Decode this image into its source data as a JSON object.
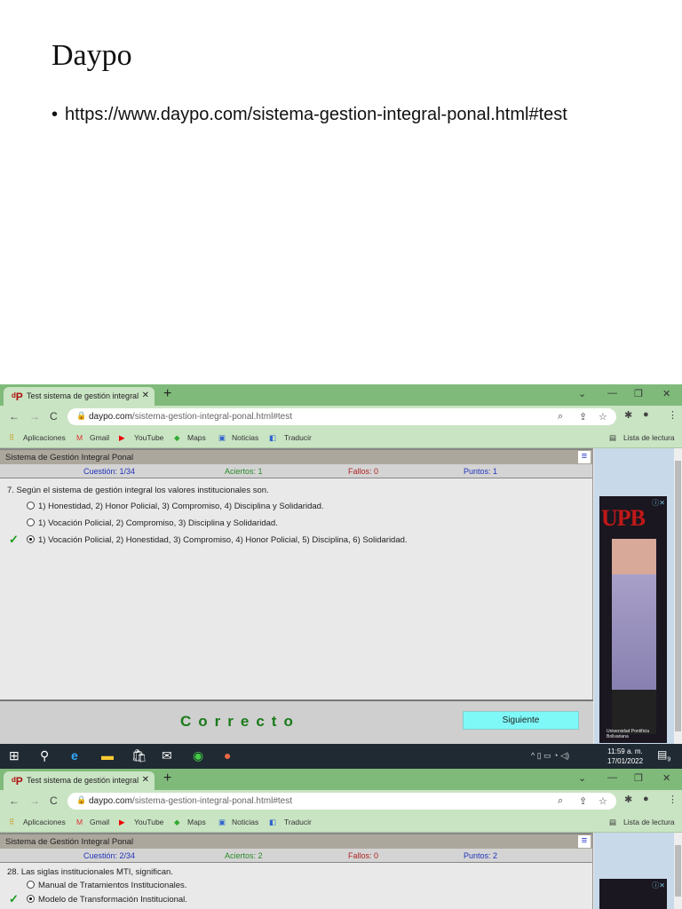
{
  "slide": {
    "title": "Daypo",
    "bullet": "https://www.daypo.com/sistema-gestion-integral-ponal.html#test"
  },
  "browser": {
    "tab_title": "Test sistema de gestión integral",
    "url_domain": "daypo.com",
    "url_path": "/sistema-gestion-integral-ponal.html#test",
    "bookmarks": [
      "Aplicaciones",
      "Gmail",
      "YouTube",
      "Maps",
      "Noticias",
      "Traducir"
    ],
    "reading_list": "Lista de lectura"
  },
  "quiz_title": "Sistema de Gestión Integral Ponal",
  "labels": {
    "question": "Cuestión:",
    "hits": "Aciertos:",
    "fails": "Fallos:",
    "points": "Puntos:"
  },
  "screens": [
    {
      "question_no": "1/34",
      "hits": "1",
      "fails": "0",
      "points": "1",
      "question": "7. Según el sistema de gestión integral los valores institucionales son.",
      "options": [
        "1) Honestidad, 2) Honor Policial, 3) Compromiso, 4) Disciplina y Solidaridad.",
        "1) Vocación Policial, 2) Compromiso, 3) Disciplina y Solidaridad.",
        "1) Vocación Policial, 2) Honestidad, 3) Compromiso, 4) Honor Policial, 5) Disciplina, 6) Solidaridad."
      ],
      "selected": 2,
      "result": "Correcto",
      "next": "Siguiente"
    },
    {
      "question_no": "2/34",
      "hits": "2",
      "fails": "0",
      "points": "2",
      "question": "28. Las siglas institucionales MTI, significan.",
      "options": [
        "Manual de Tratamientos Institucionales.",
        "Modelo de Transformación Institucional."
      ],
      "selected": 1
    }
  ],
  "ad": {
    "brand": "UPB",
    "org": "Universidad Pontificia Bolivariana"
  },
  "taskbar": {
    "time": "11:59 a. m.",
    "date": "17/01/2022",
    "notifications": "9"
  },
  "colors": {
    "chrome": "#7fba7a",
    "correct": "#1a7a1a",
    "next_button": "#7ff8f8"
  }
}
